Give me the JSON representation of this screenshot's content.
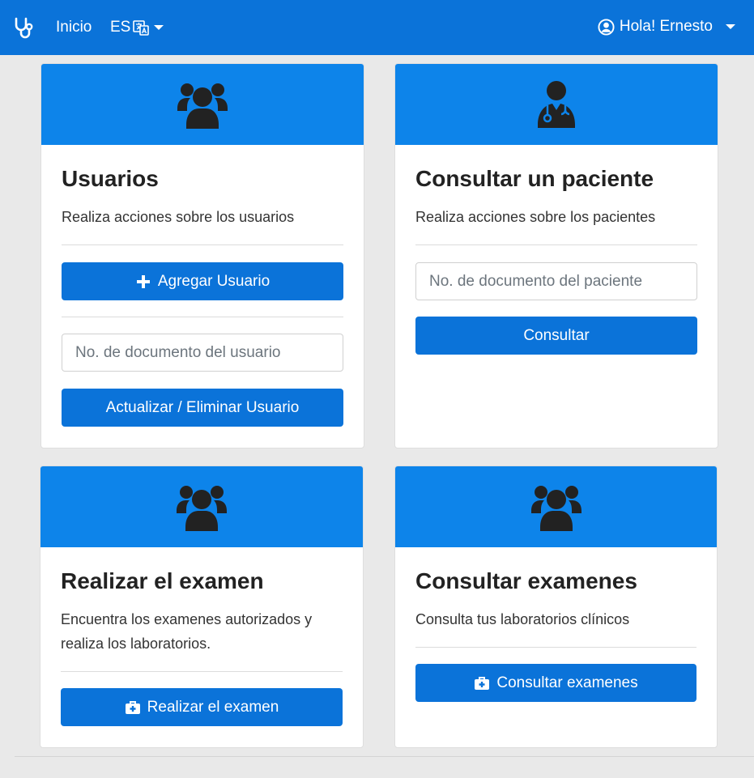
{
  "navbar": {
    "logo_icon": "stethoscope-icon",
    "home_label": "Inicio",
    "lang_label": "ES",
    "lang_icon": "translate-icon",
    "user_label": "Hola! Ernesto",
    "user_icon": "user-circle-icon"
  },
  "colors": {
    "nav": "#0b73d9",
    "card_header": "#0d84ea",
    "button": "#0b73d9"
  },
  "cards": {
    "users": {
      "icon": "users-icon",
      "title": "Usuarios",
      "description": "Realiza acciones sobre los usuarios",
      "add_button": "Agregar Usuario",
      "input_placeholder": "No. de documento del usuario",
      "update_button": "Actualizar / Eliminar Usuario"
    },
    "patient": {
      "icon": "doctor-icon",
      "title": "Consultar un paciente",
      "description": "Realiza acciones sobre los pacientes",
      "input_placeholder": "No. de documento del paciente",
      "consult_button": "Consultar"
    },
    "exam": {
      "icon": "users-icon",
      "title": "Realizar el examen",
      "description": "Encuentra los examenes autorizados y realiza los laboratorios.",
      "button": "Realizar el examen"
    },
    "results": {
      "icon": "users-icon",
      "title": "Consultar examenes",
      "description": "Consulta tus laboratorios clínicos",
      "button": "Consultar examenes"
    }
  }
}
